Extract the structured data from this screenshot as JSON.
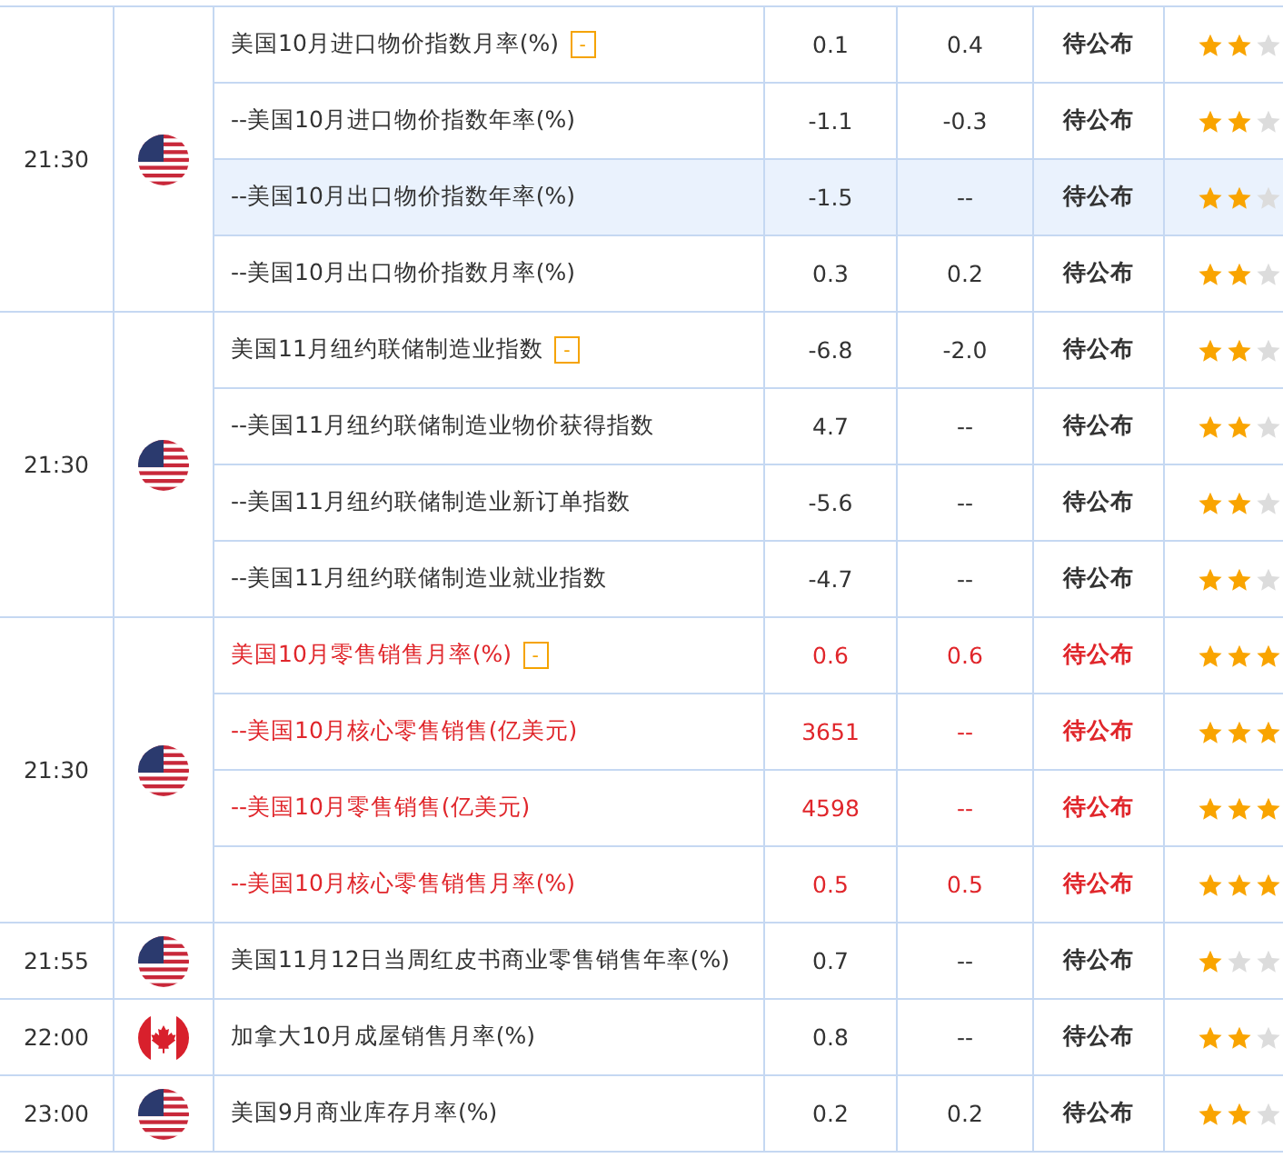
{
  "groups": [
    {
      "time": "21:30",
      "kind": "us",
      "rows": [
        {
          "name": "美国10月进口物价指数月率(%)",
          "toggle": "-",
          "previous": "0.1",
          "forecast": "0.4",
          "status": "待公布",
          "stars": 2,
          "important": false,
          "selected": false
        },
        {
          "name": "--美国10月进口物价指数年率(%)",
          "previous": "-1.1",
          "forecast": "-0.3",
          "status": "待公布",
          "stars": 2,
          "important": false,
          "selected": false
        },
        {
          "name": "--美国10月出口物价指数年率(%)",
          "previous": "-1.5",
          "forecast": "--",
          "status": "待公布",
          "stars": 2,
          "important": false,
          "selected": true
        },
        {
          "name": "--美国10月出口物价指数月率(%)",
          "previous": "0.3",
          "forecast": "0.2",
          "status": "待公布",
          "stars": 2,
          "important": false,
          "selected": false
        }
      ]
    },
    {
      "time": "21:30",
      "kind": "us",
      "rows": [
        {
          "name": "美国11月纽约联储制造业指数",
          "toggle": "-",
          "previous": "-6.8",
          "forecast": "-2.0",
          "status": "待公布",
          "stars": 2,
          "important": false,
          "selected": false
        },
        {
          "name": "--美国11月纽约联储制造业物价获得指数",
          "previous": "4.7",
          "forecast": "--",
          "status": "待公布",
          "stars": 2,
          "important": false,
          "selected": false
        },
        {
          "name": "--美国11月纽约联储制造业新订单指数",
          "previous": "-5.6",
          "forecast": "--",
          "status": "待公布",
          "stars": 2,
          "important": false,
          "selected": false
        },
        {
          "name": "--美国11月纽约联储制造业就业指数",
          "previous": "-4.7",
          "forecast": "--",
          "status": "待公布",
          "stars": 2,
          "important": false,
          "selected": false
        }
      ]
    },
    {
      "time": "21:30",
      "kind": "us",
      "rows": [
        {
          "name": "美国10月零售销售月率(%)",
          "toggle": "-",
          "previous": "0.6",
          "forecast": "0.6",
          "status": "待公布",
          "stars": 3,
          "important": true,
          "selected": false
        },
        {
          "name": "--美国10月核心零售销售(亿美元)",
          "previous": "3651",
          "forecast": "--",
          "status": "待公布",
          "stars": 3,
          "important": true,
          "selected": false
        },
        {
          "name": "--美国10月零售销售(亿美元)",
          "previous": "4598",
          "forecast": "--",
          "status": "待公布",
          "stars": 3,
          "important": true,
          "selected": false
        },
        {
          "name": "--美国10月核心零售销售月率(%)",
          "previous": "0.5",
          "forecast": "0.5",
          "status": "待公布",
          "stars": 3,
          "important": true,
          "selected": false
        }
      ]
    },
    {
      "time": "21:55",
      "kind": "us",
      "rows": [
        {
          "name": "美国11月12日当周红皮书商业零售销售年率(%)",
          "previous": "0.7",
          "forecast": "--",
          "status": "待公布",
          "stars": 1,
          "important": false,
          "selected": false
        }
      ]
    },
    {
      "time": "22:00",
      "kind": "ca",
      "rows": [
        {
          "name": "加拿大10月成屋销售月率(%)",
          "previous": "0.8",
          "forecast": "--",
          "status": "待公布",
          "stars": 2,
          "important": false,
          "selected": false
        }
      ]
    },
    {
      "time": "23:00",
      "kind": "us",
      "rows": [
        {
          "name": "美国9月商业库存月率(%)",
          "previous": "0.2",
          "forecast": "0.2",
          "status": "待公布",
          "stars": 2,
          "important": false,
          "selected": false
        }
      ]
    }
  ]
}
